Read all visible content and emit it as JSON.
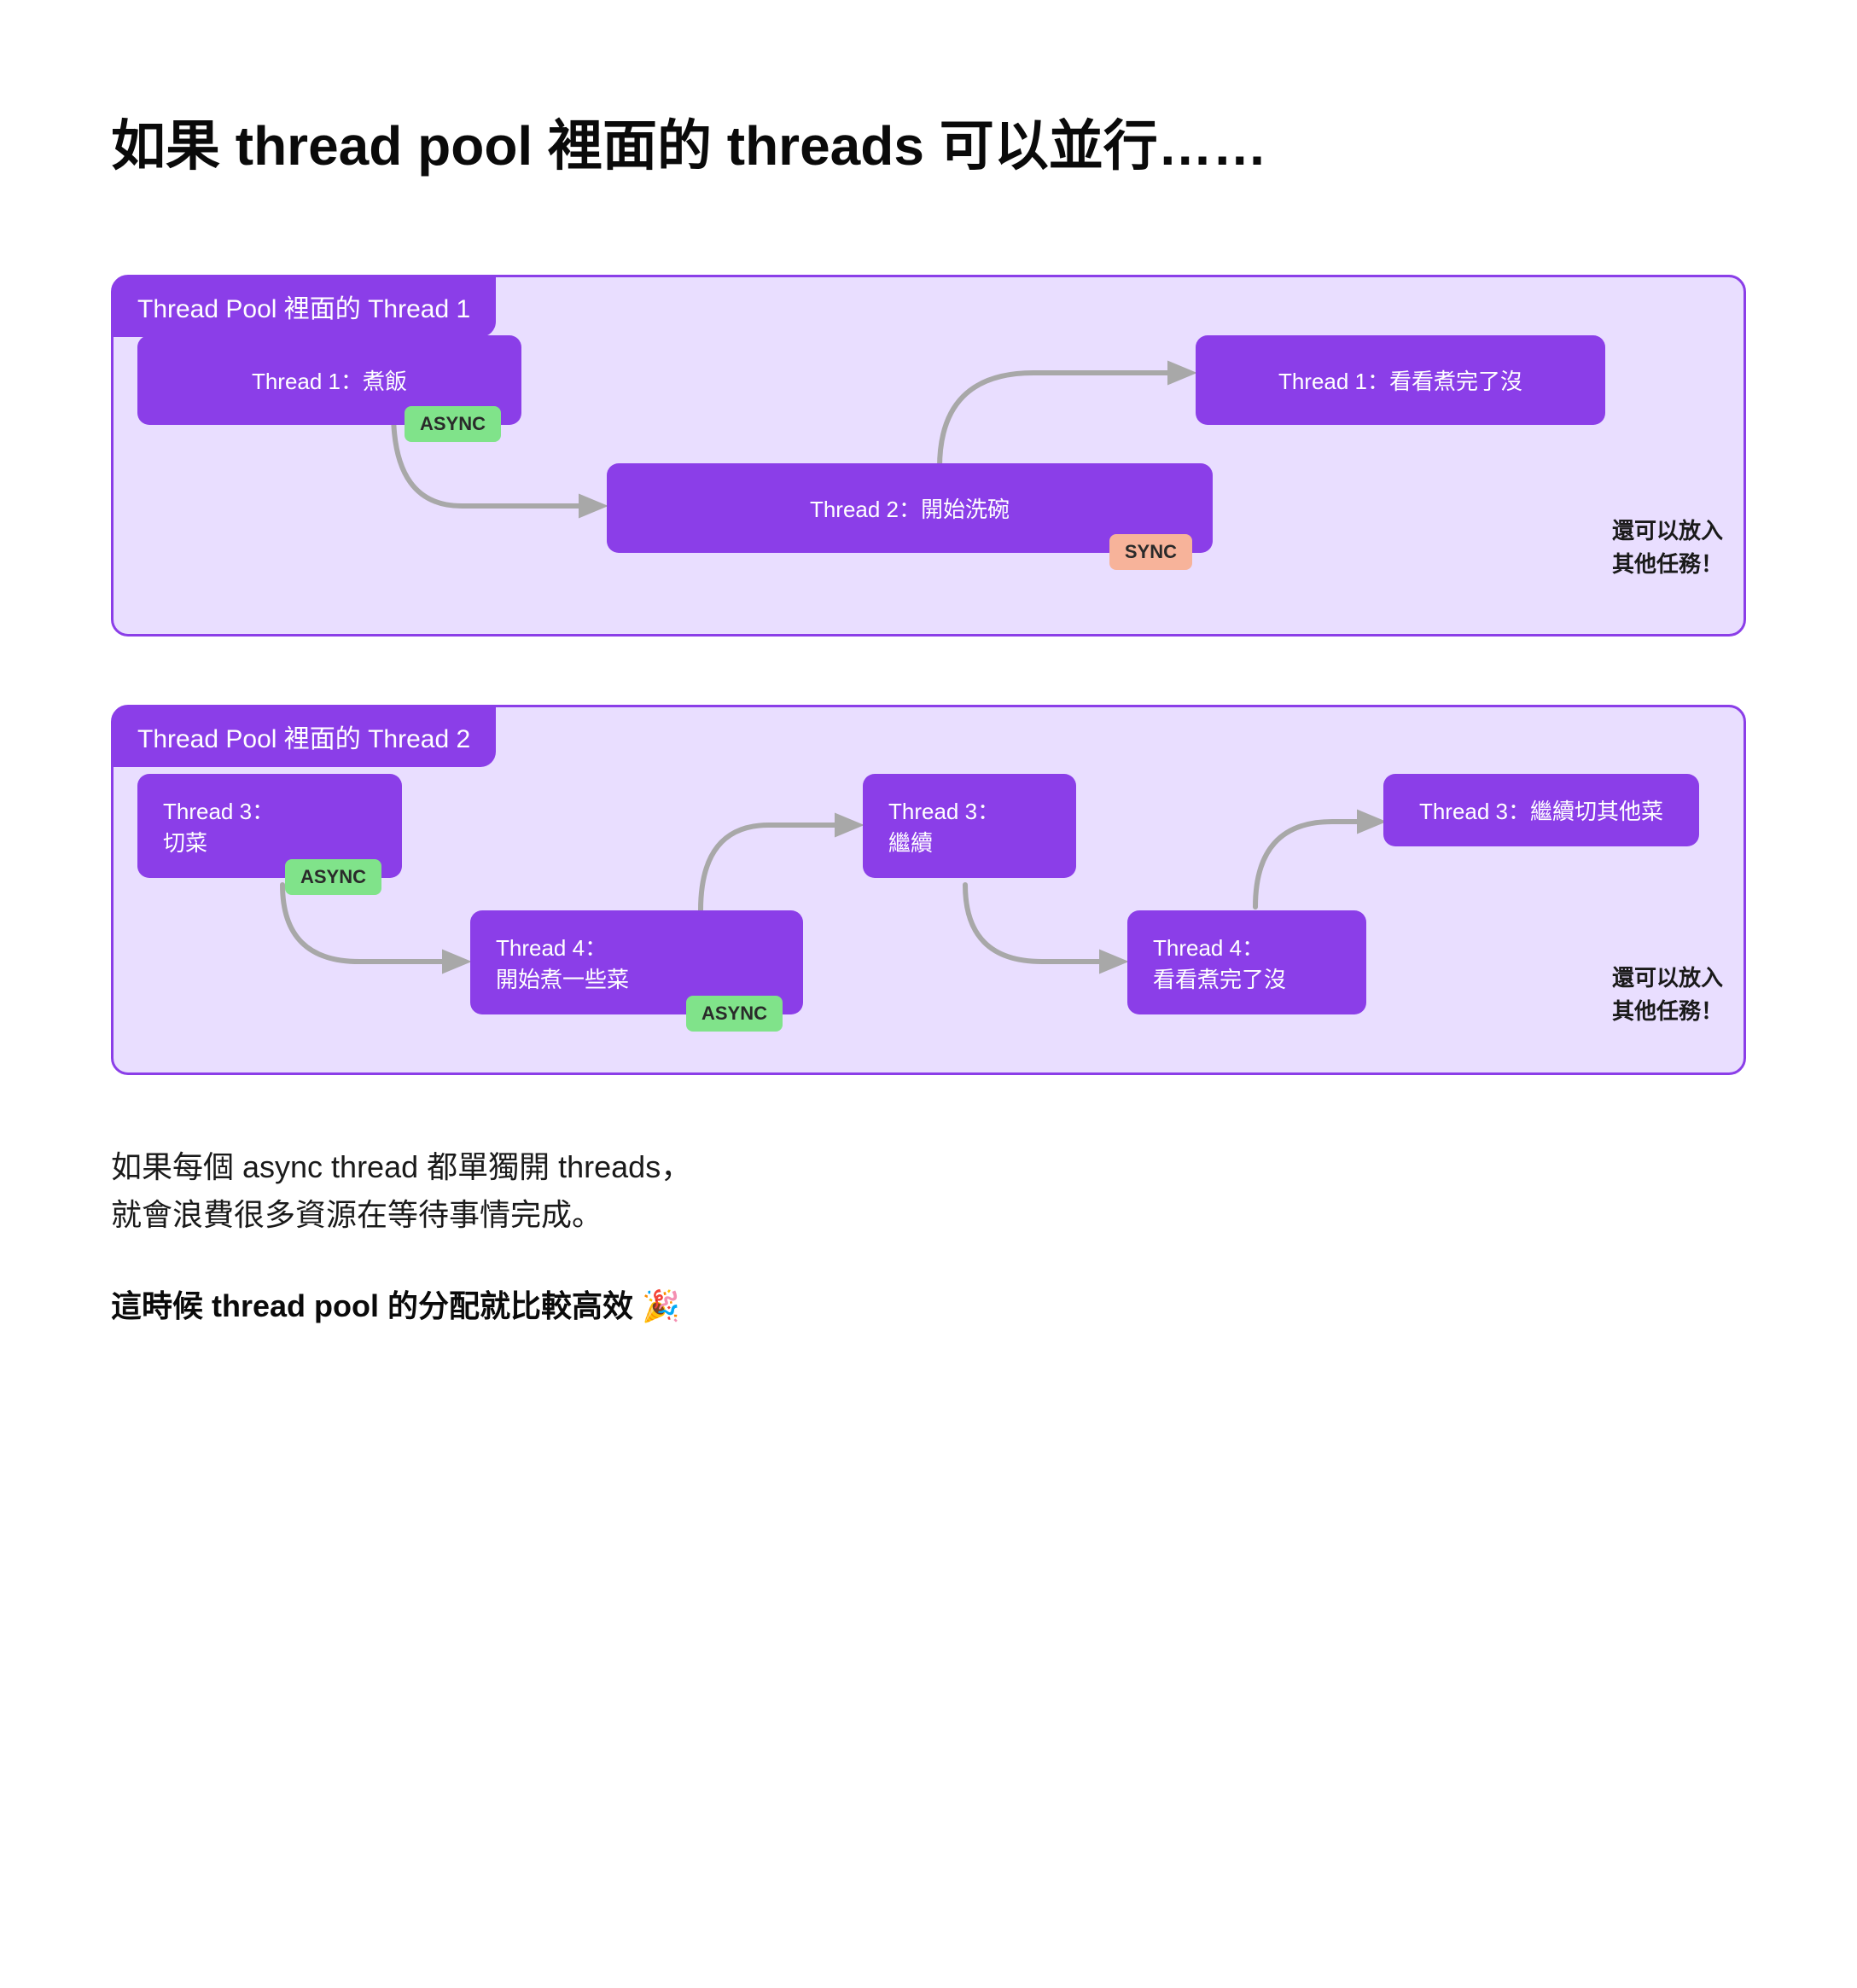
{
  "title": "如果 thread pool 裡面的 threads 可以並行……",
  "pool1": {
    "label": "Thread Pool 裡面的 Thread 1",
    "task_a": "Thread 1：煮飯",
    "task_a_badge": "ASYNC",
    "task_b": "Thread 2：開始洗碗",
    "task_b_badge": "SYNC",
    "task_c": "Thread 1：看看煮完了沒",
    "note": "還可以放入\n其他任務！"
  },
  "pool2": {
    "label": "Thread Pool 裡面的 Thread 2",
    "task_a_l1": "Thread 3：",
    "task_a_l2": "切菜",
    "task_a_badge": "ASYNC",
    "task_b_l1": "Thread 4：",
    "task_b_l2": "開始煮一些菜",
    "task_b_badge": "ASYNC",
    "task_c_l1": "Thread 3：",
    "task_c_l2": "繼續",
    "task_d_l1": "Thread 4：",
    "task_d_l2": "看看煮完了沒",
    "task_e": "Thread 3：繼續切其他菜",
    "note": "還可以放入\n其他任務！"
  },
  "para1": "如果每個 async thread 都單獨開 threads，",
  "para2": "就會浪費很多資源在等待事情完成。",
  "para3": "這時候 thread pool 的分配就比較高效 🎉"
}
